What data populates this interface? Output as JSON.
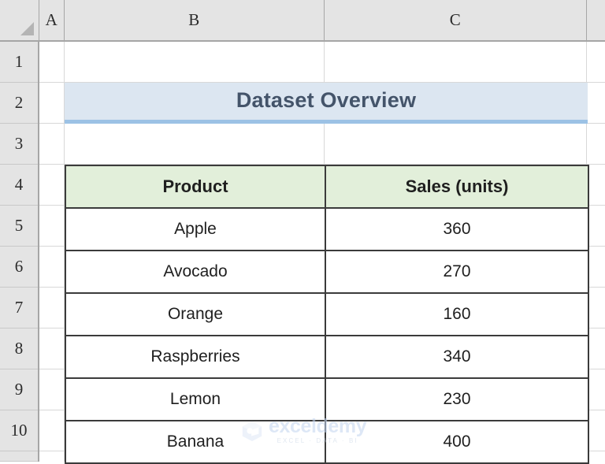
{
  "spreadsheet": {
    "column_headers": [
      "A",
      "B",
      "C"
    ],
    "row_headers": [
      "1",
      "2",
      "3",
      "4",
      "5",
      "6",
      "7",
      "8",
      "9",
      "10"
    ],
    "select_all_icon": "select-all-corner-triangle"
  },
  "title_banner": {
    "text": "Dataset Overview",
    "background_color": "#dce6f1",
    "underline_color": "#9cc2e5",
    "text_color": "#44546a"
  },
  "table": {
    "header_background": "#e2efda",
    "border_color": "#3b3b3b",
    "columns": [
      "Product",
      "Sales (units)"
    ],
    "rows": [
      {
        "product": "Apple",
        "sales": "360"
      },
      {
        "product": "Avocado",
        "sales": "270"
      },
      {
        "product": "Orange",
        "sales": "160"
      },
      {
        "product": "Raspberries",
        "sales": "340"
      },
      {
        "product": "Lemon",
        "sales": "230"
      },
      {
        "product": "Banana",
        "sales": "400"
      }
    ]
  },
  "watermark": {
    "name": "exceldemy",
    "tagline": "EXCEL · DATA · BI",
    "color": "#c3d5ef"
  }
}
